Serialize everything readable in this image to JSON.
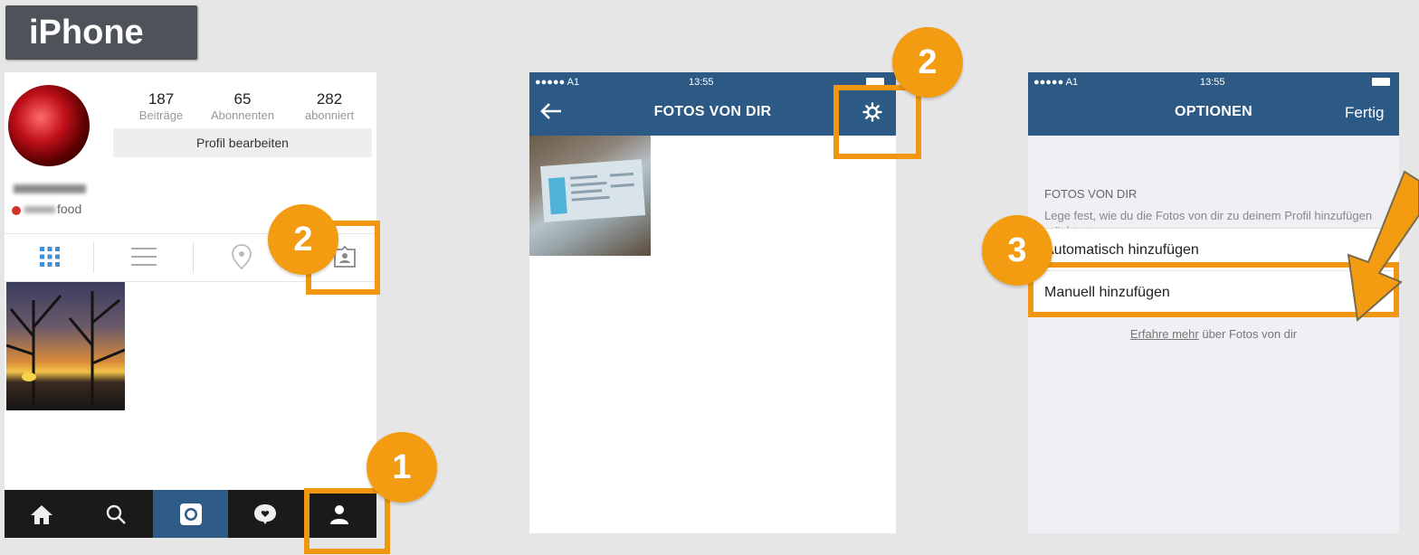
{
  "platform_label": "iPhone",
  "colors": {
    "accent_orange": "#f39c12",
    "nav_blue": "#2c5a85"
  },
  "steps": {
    "one": "1",
    "two": "2",
    "three": "3"
  },
  "profile": {
    "stats": [
      {
        "value": "187",
        "label": "Beiträge"
      },
      {
        "value": "65",
        "label": "Abonnenten"
      },
      {
        "value": "282",
        "label": "abonniert"
      }
    ],
    "edit_button": "Profil bearbeiten",
    "bio_text": "food",
    "tabs": [
      "grid-icon",
      "list-icon",
      "location-icon",
      "tagged-photos-icon"
    ],
    "bottom_nav": [
      "home-icon",
      "search-icon",
      "camera-icon",
      "activity-icon",
      "profile-icon"
    ]
  },
  "fotos_screen": {
    "status": {
      "carrier": "●●●●● A1",
      "time": "13:55"
    },
    "title": "FOTOS VON DIR"
  },
  "options_screen": {
    "status": {
      "carrier": "●●●●● A1",
      "time": "13:55"
    },
    "title": "OPTIONEN",
    "done_label": "Fertig",
    "section_header": "FOTOS VON DIR",
    "section_desc": "Lege fest, wie du die Fotos von dir zu deinem Profil hinzufügen möchtest.",
    "options": [
      "Automatisch hinzufügen",
      "Manuell hinzufügen"
    ],
    "selected_option": "Manuell hinzufügen",
    "footnote_link": "Erfahre mehr",
    "footnote_text": " über Fotos von dir"
  }
}
